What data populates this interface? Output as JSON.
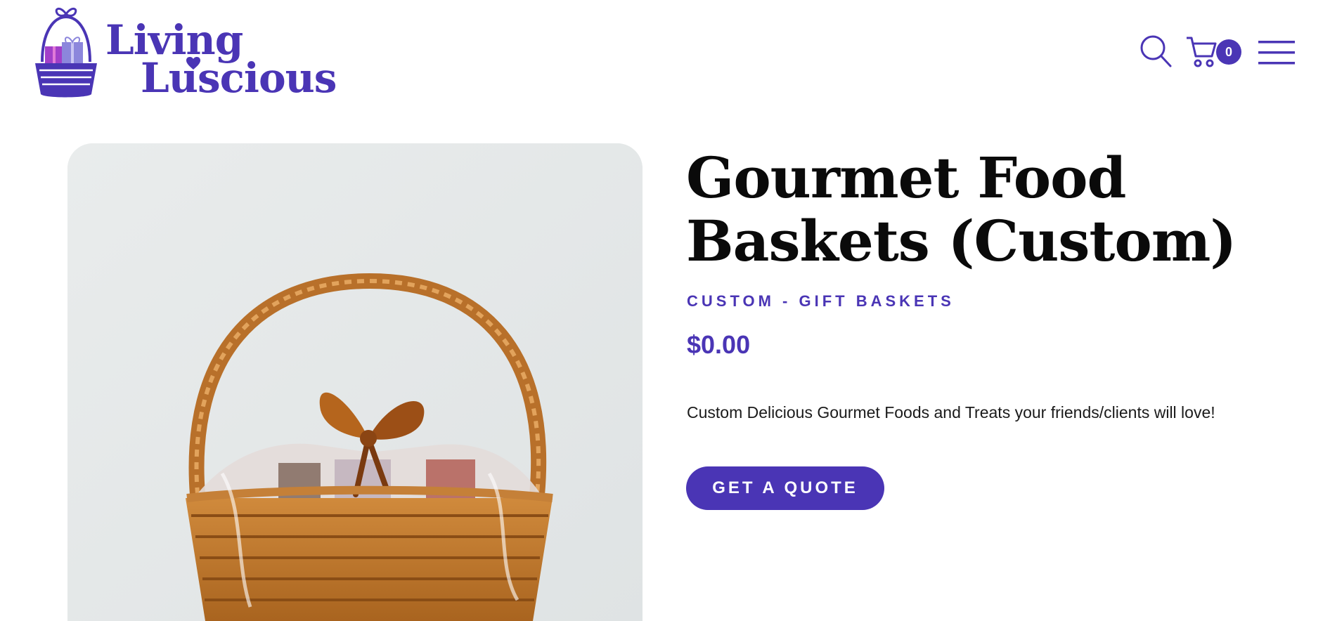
{
  "brand": {
    "line1": "Living",
    "line2": "Luscious",
    "accent_color": "#4a35b5"
  },
  "header": {
    "icons": [
      "search-icon",
      "cart-icon",
      "hamburger-menu-icon"
    ],
    "cart_count": "0"
  },
  "product": {
    "title": "Gourmet Food Baskets (Custom)",
    "category": "CUSTOM - GIFT BASKETS",
    "price": "$0.00",
    "description": "Custom Delicious Gourmet Foods and Treats your friends/clients will love!",
    "cta_label": "GET A QUOTE"
  }
}
